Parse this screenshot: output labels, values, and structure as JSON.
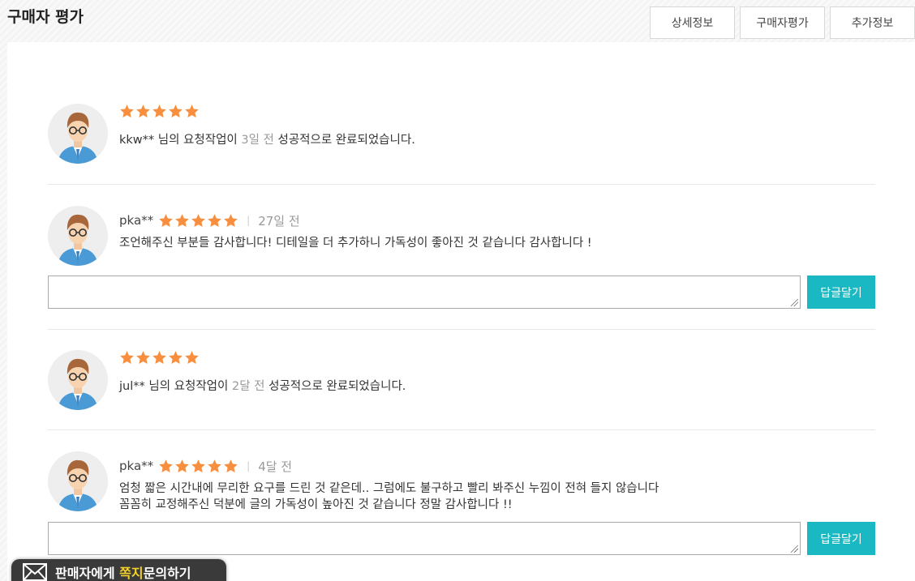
{
  "header": {
    "title": "구매자 평가",
    "tabs": [
      "상세정보",
      "구매자평가",
      "추가정보"
    ]
  },
  "colors": {
    "star": "#f78f3f",
    "reply_button": "#19b8c2",
    "muted_text": "#999999"
  },
  "reviews": [
    {
      "type": "system",
      "rating": 5,
      "user": "kkw**",
      "text_before": " 님의 요청작업이 ",
      "time": "3일 전",
      "text_after": " 성공적으로 완료되었습니다."
    },
    {
      "type": "comment",
      "rating": 5,
      "user": "pka**",
      "date": "27일 전",
      "lines": [
        "조언해주신 부분들 감사합니다! 디테일을 더 추가하니 가독성이 좋아진 것 같습니다 감사합니다 !"
      ],
      "reply_button": "답글달기"
    },
    {
      "type": "system",
      "rating": 5,
      "user": "jul**",
      "text_before": " 님의 요청작업이 ",
      "time": "2달 전",
      "text_after": " 성공적으로 완료되었습니다."
    },
    {
      "type": "comment",
      "rating": 5,
      "user": "pka**",
      "date": "4달 전",
      "lines": [
        "엄청 짧은 시간내에 무리한 요구를 드린 것 같은데.. 그럼에도 불구하고 빨리 봐주신 누낌이 전혀 들지 않습니다",
        "꼼꼼히 교정해주신 덕분에 글의 가독성이 높아진 것 같습니다 정말 감사합니다 !!"
      ],
      "reply_button": "답글달기"
    }
  ],
  "floating_button": {
    "icon": "mail-icon",
    "part1": "판매자에게 ",
    "highlight": "쪽지",
    "part2": "문의하기"
  }
}
